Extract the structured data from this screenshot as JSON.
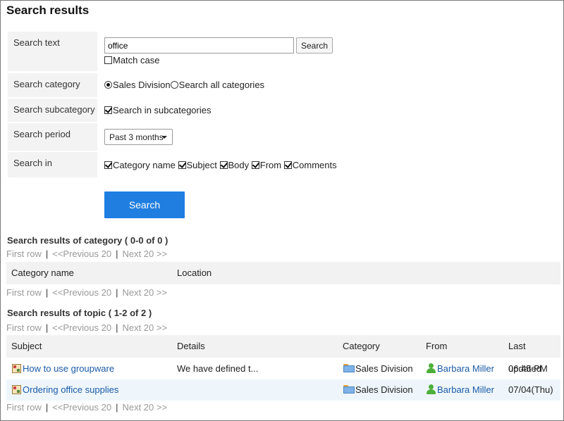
{
  "page": {
    "title": "Search results"
  },
  "form": {
    "search_text_label": "Search text",
    "search_text_value": "office",
    "search_button": "Search",
    "match_case_label": "Match case",
    "match_case_checked": false,
    "category_label": "Search category",
    "category_options": [
      {
        "label": "Sales Division",
        "checked": true
      },
      {
        "label": "Search all categories",
        "checked": false
      }
    ],
    "subcategory_label": "Search subcategory",
    "subcategory_option": "Search in subcategories",
    "subcategory_checked": true,
    "period_label": "Search period",
    "period_value": "Past 3 months",
    "search_in_label": "Search in",
    "search_in_options": [
      {
        "label": "Category name",
        "checked": true
      },
      {
        "label": "Subject",
        "checked": true
      },
      {
        "label": "Body",
        "checked": true
      },
      {
        "label": "From",
        "checked": true
      },
      {
        "label": "Comments",
        "checked": true
      }
    ],
    "submit_button": "Search"
  },
  "pager": {
    "first": "First row",
    "sep": "|",
    "prev": "<<Previous 20",
    "next": "Next 20 >>"
  },
  "category_results": {
    "title": "Search results of category ( 0-0 of 0 )",
    "columns": [
      "Category name",
      "Location"
    ]
  },
  "topic_results": {
    "title": "Search results of topic ( 1-2 of 2 )",
    "columns": [
      "Subject",
      "Details",
      "Category",
      "From",
      "Last updated"
    ],
    "rows": [
      {
        "subject": "How to use groupware",
        "details": "We have defined t...",
        "category": "Sales Division",
        "from": "Barbara Miller",
        "updated": "06:45 PM"
      },
      {
        "subject": "Ordering office supplies",
        "details": "",
        "category": "Sales Division",
        "from": "Barbara Miller",
        "updated": "07/04(Thu)"
      }
    ]
  }
}
